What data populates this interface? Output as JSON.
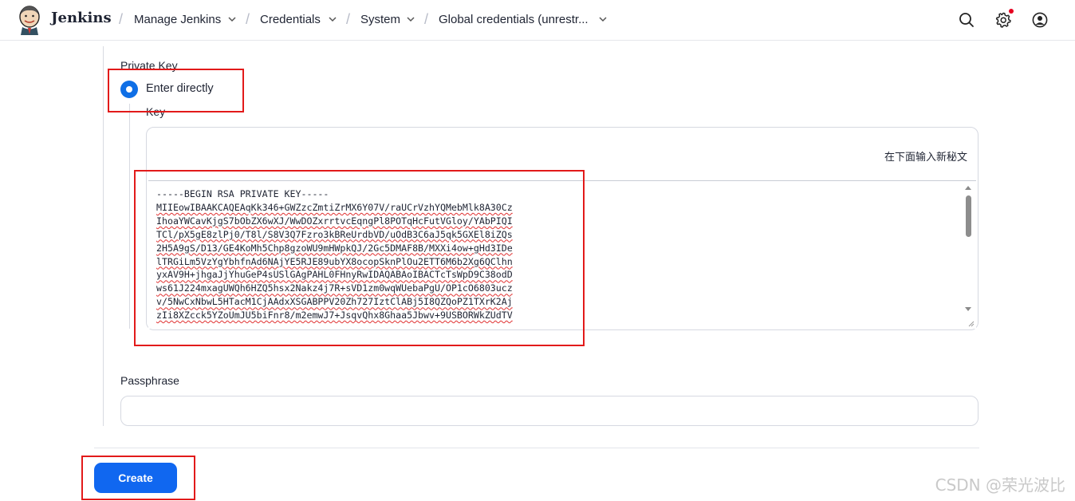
{
  "header": {
    "brand": "Jenkins",
    "breadcrumbs": [
      "Manage Jenkins",
      "Credentials",
      "System",
      "Global credentials (unrestr..."
    ],
    "icons": [
      "search-icon",
      "gear-icon",
      "user-icon"
    ]
  },
  "form": {
    "private_key_label": "Private Key",
    "enter_directly_label": "Enter directly",
    "key_label": "Key",
    "key_hint": "在下面输入新秘文",
    "key_value_lines": [
      "-----BEGIN RSA PRIVATE KEY-----",
      "MIIEowIBAAKCAQEAqKk346+GWZzcZmtiZrMX6Y07V/raUCrVzhYQMebMlk8A30Cz",
      "IhoaYWCavKjgS7bObZX6wXJ/WwDOZxrrtvcEqngPl8POTqHcFutVGloy/YAbPIQI",
      "TCl/pX5gE8zlPj0/T8l/S8V3Q7Fzro3kBReUrdbVD/uOdB3C6aJ5qk5GXEl8iZQs",
      "2H5A9gS/D13/GE4KoMh5Chp8gzoWU9mHWpkQJ/2Gc5DMAF8B/MXXi4ow+gHd3IDe",
      "lTRGiLm5VzYgYbhfnAd6NAjYE5RJE89ubYX8ocopSknPlOu2ETT6M6b2Xg6QClhn",
      "yxAV9H+jhgaJjYhuGeP4sUSlGAgPAHL0FHnyRwIDAQABAoIBACTcTsWpD9C38odD",
      "ws61J224mxagUWQh6HZQ5hsx2Nakz4j7R+sVD1zm0wqWUebaPgU/OP1cO6803ucz",
      "v/5NwCxNbwL5HTacM1CjAAdxXSGABPPV20Zh727IztClABj5I8QZQoPZ1TXrK2Aj",
      "zIi8XZcck5YZoUmJU5biFnr8/m2emwJ7+JsqvQhx8Ghaa5Jbwv+9USBORWkZUdTV"
    ],
    "passphrase_label": "Passphrase",
    "passphrase_value": "",
    "create_label": "Create"
  },
  "watermark": "CSDN @荣光波比",
  "colors": {
    "accent": "#1067f0",
    "annotation": "#e21a1a"
  }
}
